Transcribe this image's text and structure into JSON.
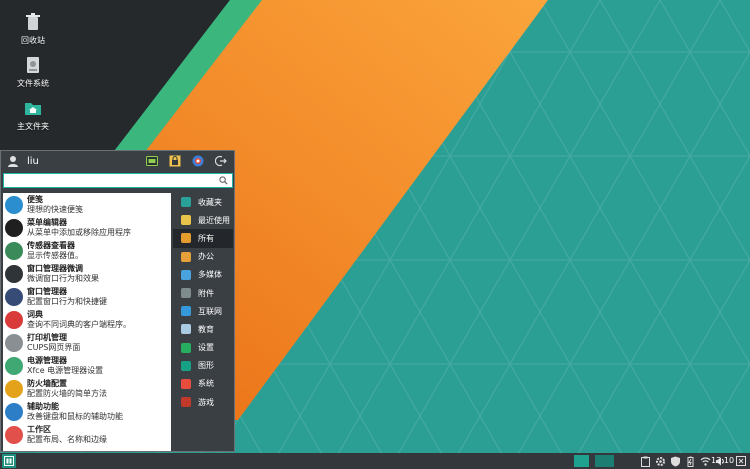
{
  "desktop": {
    "icons": [
      {
        "label": "回收站",
        "icon": "trash-icon"
      },
      {
        "label": "文件系统",
        "icon": "drive-icon"
      },
      {
        "label": "主文件夹",
        "icon": "home-folder-icon"
      }
    ]
  },
  "menu": {
    "username": "liu",
    "search": {
      "value": "",
      "placeholder": ""
    },
    "apps": [
      {
        "name": "便笺",
        "desc": "理想的快速便笺",
        "color": "#2b8ecf",
        "icon": "notes-icon"
      },
      {
        "name": "菜单编辑器",
        "desc": "从菜单中添加或移除应用程序",
        "color": "#1f1f1f",
        "icon": "menu-editor-icon"
      },
      {
        "name": "传感器查看器",
        "desc": "显示传感器值。",
        "color": "#3a8a5a",
        "icon": "sensors-icon"
      },
      {
        "name": "窗口管理器微调",
        "desc": "微调窗口行为和效果",
        "color": "#2f3438",
        "icon": "window-tweaks-icon"
      },
      {
        "name": "窗口管理器",
        "desc": "配置窗口行为和快捷键",
        "color": "#364b75",
        "icon": "window-manager-icon"
      },
      {
        "name": "词典",
        "desc": "查询不同词典的客户端程序。",
        "color": "#d93b3b",
        "icon": "dictionary-icon"
      },
      {
        "name": "打印机管理",
        "desc": "CUPS网页界面",
        "color": "#8a8f94",
        "icon": "printer-icon"
      },
      {
        "name": "电源管理器",
        "desc": "Xfce 电源管理器设置",
        "color": "#3fa873",
        "icon": "power-manager-icon"
      },
      {
        "name": "防火墙配置",
        "desc": "配置防火墙的简单方法",
        "color": "#e3a21a",
        "icon": "firewall-icon"
      },
      {
        "name": "辅助功能",
        "desc": "改善键盘和鼠标的辅助功能",
        "color": "#2c7fc7",
        "icon": "accessibility-icon"
      },
      {
        "name": "工作区",
        "desc": "配置布局、名称和边缘",
        "color": "#e2504c",
        "icon": "workspaces-icon"
      }
    ],
    "categories": [
      {
        "label": "收藏夹",
        "icon": "bookmark-icon",
        "color": "#2aa198"
      },
      {
        "label": "最近使用",
        "icon": "clock-icon",
        "color": "#e8c54a"
      },
      {
        "label": "所有",
        "icon": "folder-icon",
        "color": "#e39b2e",
        "active": true
      },
      {
        "label": "办公",
        "icon": "briefcase-icon",
        "color": "#e6a03a"
      },
      {
        "label": "多媒体",
        "icon": "music-icon",
        "color": "#4aa3df"
      },
      {
        "label": "附件",
        "icon": "accessories-icon",
        "color": "#7f8c8d"
      },
      {
        "label": "互联网",
        "icon": "globe-icon",
        "color": "#3498db"
      },
      {
        "label": "教育",
        "icon": "flask-icon",
        "color": "#a9cce3"
      },
      {
        "label": "设置",
        "icon": "settings-icon",
        "color": "#27ae60"
      },
      {
        "label": "图形",
        "icon": "graphics-icon",
        "color": "#16a085"
      },
      {
        "label": "系统",
        "icon": "system-icon",
        "color": "#e74c3c"
      },
      {
        "label": "游戏",
        "icon": "gamepad-icon",
        "color": "#c0392b"
      }
    ]
  },
  "panel": {
    "clock": "13:10"
  },
  "colors": {
    "accent": "#1fb3a3",
    "orange": "#f07d1c",
    "panel": "#34383c"
  }
}
